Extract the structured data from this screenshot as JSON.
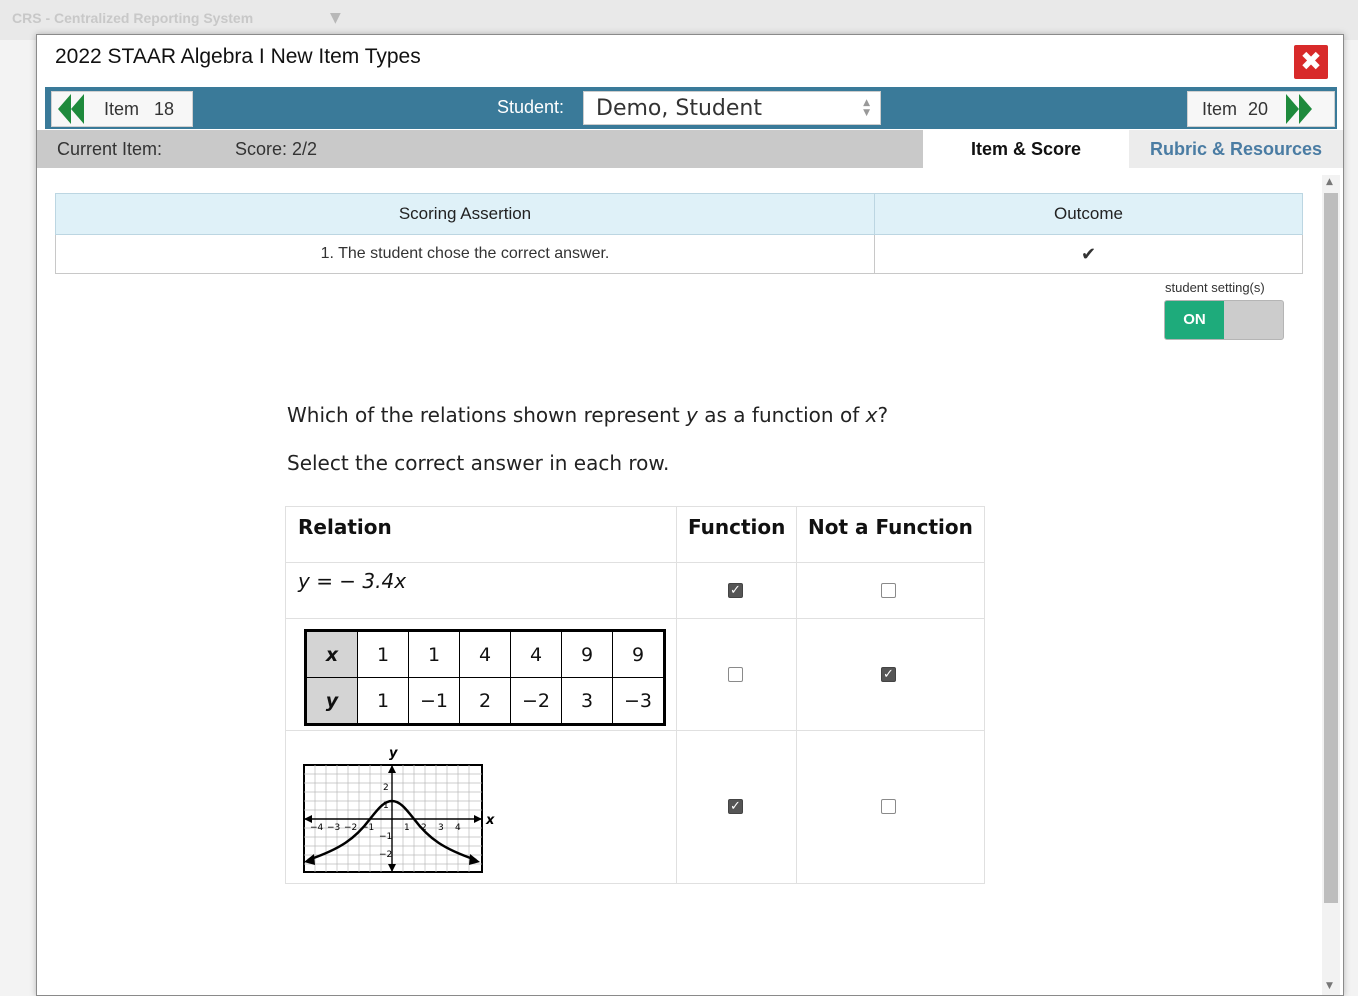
{
  "background": {
    "app_title": "CRS - Centralized Reporting System"
  },
  "modal": {
    "title": "2022 STAAR Algebra I New Item Types",
    "close_symbol": "✖"
  },
  "nav": {
    "prev_item_label": "Item",
    "prev_item_number": "18",
    "student_label": "Student:",
    "student_value": "Demo, Student",
    "next_item_label": "Item",
    "next_item_number": "20"
  },
  "info": {
    "current_item_label": "Current Item:",
    "score_label": "Score: 2/2"
  },
  "tabs": [
    {
      "label": "Item & Score",
      "active": true
    },
    {
      "label": "Rubric & Resources",
      "active": false
    }
  ],
  "scoring_table": {
    "headers": [
      "Scoring Assertion",
      "Outcome"
    ],
    "rows": [
      {
        "assertion": "1. The student chose the correct answer.",
        "outcome": "✔"
      }
    ]
  },
  "student_settings": {
    "label": "student setting(s)",
    "state": "ON"
  },
  "question": {
    "prompt_pre": "Which of the relations shown represent",
    "var_y": "y",
    "prompt_mid": "as a function of",
    "var_x": "x",
    "prompt_end": "?",
    "instruction": "Select the correct answer in each row."
  },
  "grid": {
    "headers": [
      "Relation",
      "Function",
      "Not a Function"
    ],
    "row1_equation": "y = − 3.4x",
    "row2_table": {
      "x_label": "x",
      "y_label": "y",
      "x_values": [
        "1",
        "1",
        "4",
        "4",
        "9",
        "9"
      ],
      "y_values": [
        "1",
        "−1",
        "2",
        "−2",
        "3",
        "−3"
      ]
    },
    "row3_graph": {
      "x_axis_label": "x",
      "y_axis_label": "y",
      "x_ticks": [
        "−4",
        "−3",
        "−2",
        "−1",
        "1",
        "2",
        "3",
        "4"
      ],
      "y_ticks": [
        "2",
        "1",
        "−1",
        "−2"
      ]
    },
    "selections": [
      {
        "function": true,
        "not_function": false
      },
      {
        "function": false,
        "not_function": true
      },
      {
        "function": true,
        "not_function": false
      }
    ]
  },
  "colors": {
    "nav_bar": "#3a7a99",
    "nav_arrow": "#1e8a3c",
    "close_button": "#d82a2a",
    "toggle_on": "#1eab7b",
    "tab_inactive_text": "#4a7ca3",
    "scoring_header": "#dff1f8"
  }
}
